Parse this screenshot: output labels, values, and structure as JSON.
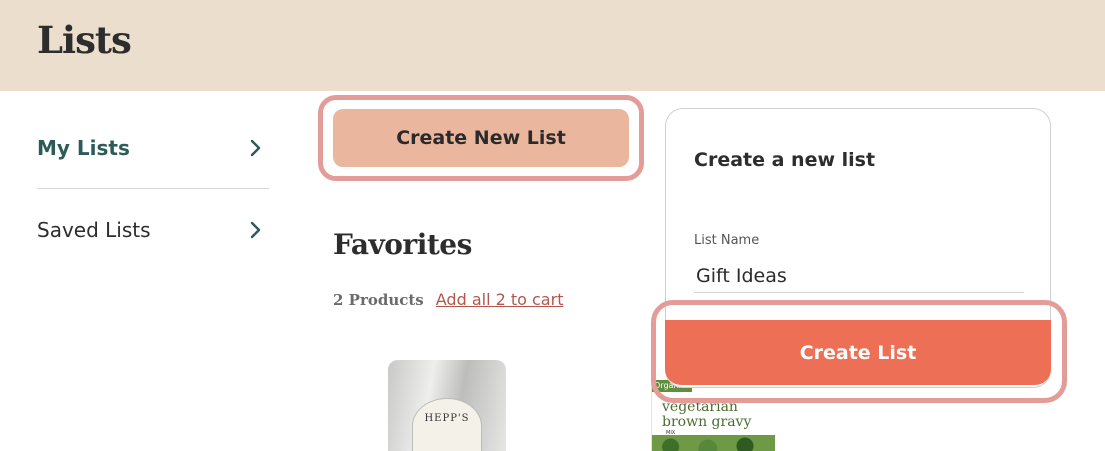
{
  "header": {
    "title": "Lists"
  },
  "sidebar": {
    "items": [
      {
        "label": "My Lists",
        "active": true,
        "icon": "chevron-right-icon"
      },
      {
        "label": "Saved Lists",
        "active": false,
        "icon": "chevron-right-icon"
      }
    ]
  },
  "actions": {
    "create_new_list_label": "Create New List"
  },
  "favorites": {
    "title": "Favorites",
    "product_count": "2 Products",
    "add_all_link": "Add all 2 to cart",
    "products": [
      {
        "brand_text": "HEPP'S"
      },
      {
        "badge_text": "Organic",
        "name_line1": "vegetarian",
        "name_line2": "brown gravy",
        "sub": "MIX"
      }
    ]
  },
  "create_panel": {
    "title": "Create a new list",
    "field_label": "List Name",
    "field_value": "Gift Ideas",
    "submit_label": "Create List"
  },
  "colors": {
    "header_bg": "#ecdecc",
    "accent_teal": "#2e5b57",
    "create_new_bg": "#eab79e",
    "create_list_bg": "#ec6f56",
    "highlight_ring": "#e49c98",
    "link": "#b3574d"
  }
}
